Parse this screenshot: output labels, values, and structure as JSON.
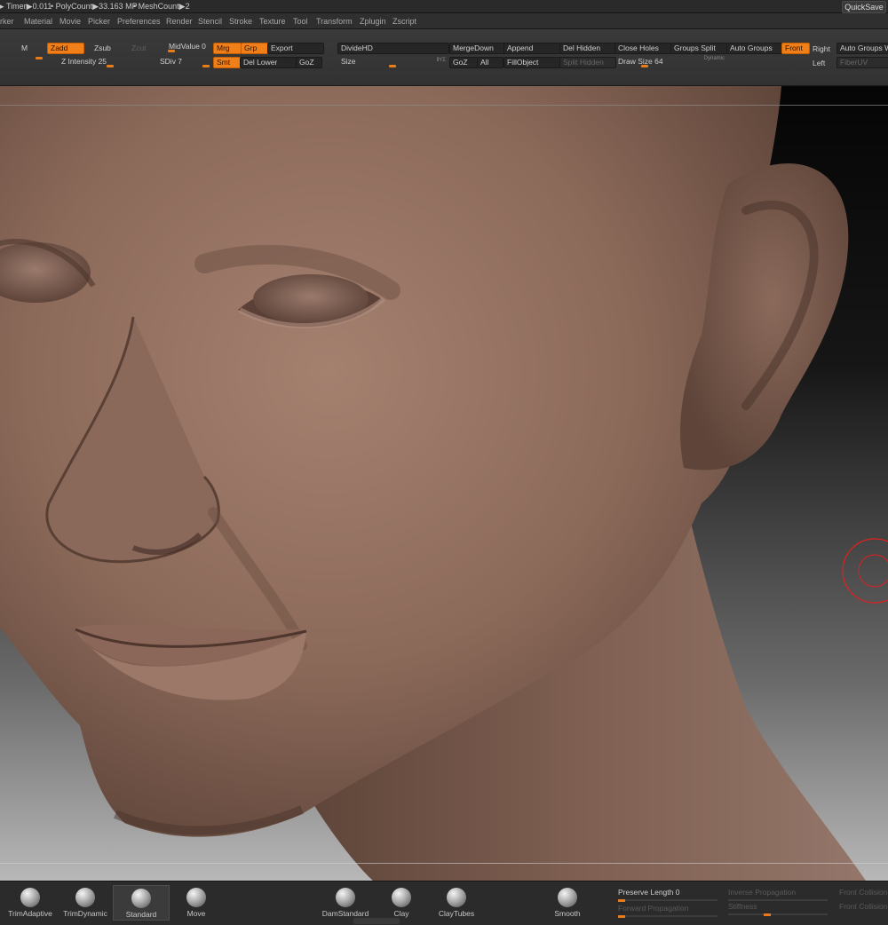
{
  "status": {
    "timer": "Timer▶0.011",
    "polycount": "• PolyCount▶33.163 MP",
    "meshcount": "• MeshCount▶2",
    "arrow": "▸",
    "quicksave": "QuickSave"
  },
  "menu": [
    "rker",
    "Material",
    "Movie",
    "Picker",
    "Preferences",
    "Render",
    "Stencil",
    "Stroke",
    "Texture",
    "Tool",
    "Transform",
    "Zplugin",
    "Zscript"
  ],
  "toolbar": {
    "m": "M",
    "zadd": "Zadd",
    "zsub": "Zsub",
    "zcut": "Zcut",
    "z_intensity": "Z Intensity 25",
    "midvalue": "MidValue 0",
    "mrg": "Mrg",
    "grp": "Grp",
    "export": "Export",
    "sdiv": "SDiv 7",
    "smt": "Smt",
    "del_lower": "Del Lower",
    "goz": "GoZ",
    "dividehd": "DivideHD",
    "size": "Size",
    "size_icons": "ⅡΥΣ",
    "mergedown": "MergeDown",
    "goz2": "GoZ",
    "all": "All",
    "append": "Append",
    "fillobject": "FillObject",
    "del_hidden": "Del Hidden",
    "split_hidden": "Split Hidden",
    "close_holes": "Close Holes",
    "draw_size": "Draw Size 64",
    "dynamic": "Dynamic",
    "groups_split": "Groups Split",
    "auto_groups": "Auto Groups",
    "front": "Front",
    "right": "Right",
    "left": "Left",
    "auto_groups_w": "Auto Groups W",
    "fiberuv": "FiberUV"
  },
  "brushes": [
    {
      "label": "TrimAdaptive"
    },
    {
      "label": "TrimDynamic"
    },
    {
      "label": "Standard"
    },
    {
      "label": "Move"
    },
    {
      "label": "DamStandard"
    },
    {
      "label": "Clay"
    },
    {
      "label": "ClayTubes"
    },
    {
      "label": "Smooth"
    }
  ],
  "shelf_sliders": {
    "preserve_length": "Preserve Length 0",
    "forward_propagation": "Forward Propagation",
    "inverse_propagation": "Inverse Propagation",
    "stiffness": "Stiffness",
    "front_collision": "Front Collision",
    "front_collision_2": "Front Collision"
  },
  "colors": {
    "accent": "#f07f1a",
    "panel": "#323232",
    "skin": "#8c6a5a"
  }
}
